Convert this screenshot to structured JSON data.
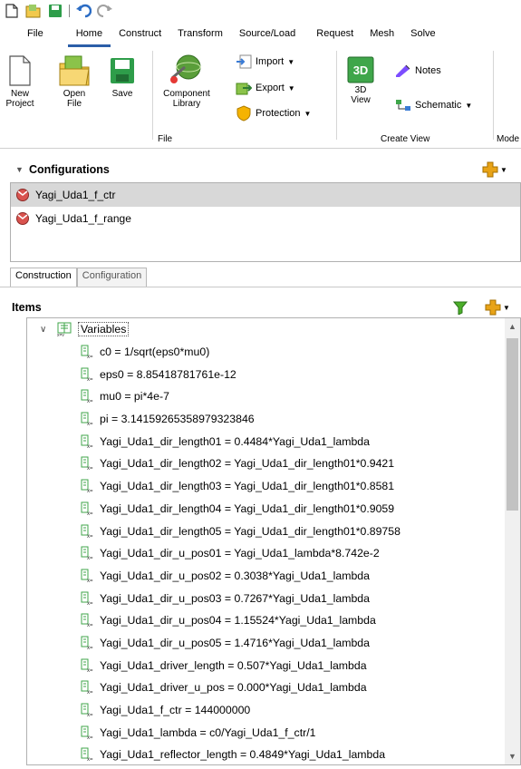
{
  "ribbon": {
    "tabs": [
      "File",
      "Home",
      "Construct",
      "Transform",
      "Source/Load",
      "Request",
      "Mesh",
      "Solve"
    ],
    "active_tab": "Home",
    "buttons": {
      "new_project": "New\nProject",
      "open_file": "Open\nFile",
      "save": "Save",
      "component_library": "Component\nLibrary",
      "import": "Import",
      "export": "Export",
      "protection": "Protection",
      "view_3d": "3D\nView",
      "notes": "Notes",
      "schematic": "Schematic"
    },
    "groups": {
      "file": "File",
      "create_view": "Create View",
      "model": "Mode"
    },
    "icon_3d_text": "3D"
  },
  "configurations": {
    "title": "Configurations",
    "items": [
      {
        "label": "Yagi_Uda1_f_ctr",
        "selected": true
      },
      {
        "label": "Yagi_Uda1_f_range",
        "selected": false
      }
    ]
  },
  "subtabs": [
    "Construction",
    "Configuration"
  ],
  "items": {
    "title": "Items",
    "root": "Variables",
    "variables": [
      "c0 = 1/sqrt(eps0*mu0)",
      "eps0 = 8.85418781761e-12",
      "mu0 = pi*4e-7",
      "pi = 3.14159265358979323846",
      "Yagi_Uda1_dir_length01 = 0.4484*Yagi_Uda1_lambda",
      "Yagi_Uda1_dir_length02 = Yagi_Uda1_dir_length01*0.9421",
      "Yagi_Uda1_dir_length03 = Yagi_Uda1_dir_length01*0.8581",
      "Yagi_Uda1_dir_length04 = Yagi_Uda1_dir_length01*0.9059",
      "Yagi_Uda1_dir_length05 = Yagi_Uda1_dir_length01*0.89758",
      "Yagi_Uda1_dir_u_pos01 = Yagi_Uda1_lambda*8.742e-2",
      "Yagi_Uda1_dir_u_pos02 = 0.3038*Yagi_Uda1_lambda",
      "Yagi_Uda1_dir_u_pos03 = 0.7267*Yagi_Uda1_lambda",
      "Yagi_Uda1_dir_u_pos04 = 1.15524*Yagi_Uda1_lambda",
      "Yagi_Uda1_dir_u_pos05 = 1.4716*Yagi_Uda1_lambda",
      "Yagi_Uda1_driver_length = 0.507*Yagi_Uda1_lambda",
      "Yagi_Uda1_driver_u_pos = 0.000*Yagi_Uda1_lambda",
      "Yagi_Uda1_f_ctr = 144000000",
      "Yagi_Uda1_lambda = c0/Yagi_Uda1_f_ctr/1",
      "Yagi_Uda1_reflector_length = 0.4849*Yagi_Uda1_lambda"
    ]
  },
  "colors": {
    "accent": "#2b5ea8",
    "selection": "#d8d8d8",
    "filter_green": "#4caf2a",
    "add_orange": "#e8a317"
  }
}
